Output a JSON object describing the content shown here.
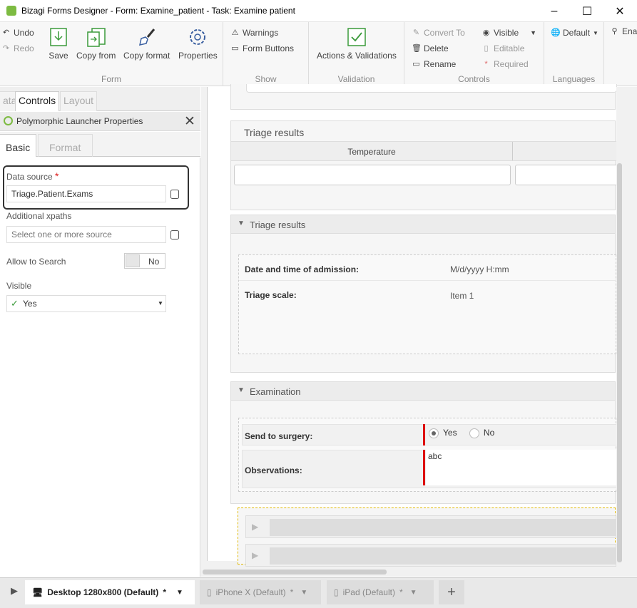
{
  "window": {
    "title": "Bizagi Forms Designer  - Form: Examine_patient - Task:  Examine patient",
    "minimize": "–",
    "maximize": "☐",
    "close": "✕"
  },
  "ribbon": {
    "undo": "Undo",
    "redo": "Redo",
    "save": "Save",
    "copy_from": "Copy from",
    "copy_format": "Copy format",
    "properties": "Properties",
    "group_form": "Form",
    "warnings": "Warnings",
    "form_buttons": "Form Buttons",
    "group_show": "Show",
    "actions_validations": "Actions & Validations",
    "group_validation": "Validation",
    "convert_to": "Convert To",
    "delete": "Delete",
    "rename": "Rename",
    "visible": "Visible",
    "editable": "Editable",
    "required": "Required",
    "group_controls": "Controls",
    "language_default": "Default",
    "group_languages": "Languages",
    "enable": "Ena"
  },
  "left_tabs": [
    "ata",
    "Controls",
    "Layout"
  ],
  "properties_panel": {
    "title": "Polymorphic Launcher Properties",
    "tabs": [
      "Basic",
      "Format"
    ],
    "data_source_label": "Data source",
    "data_source_required": "*",
    "data_source_value": "Triage.Patient.Exams",
    "additional_xpaths_label": "Additional xpaths",
    "additional_xpaths_placeholder": "Select one or more source",
    "allow_search_label": "Allow to Search",
    "allow_search_value": "No",
    "visible_label": "Visible",
    "visible_value": "Yes"
  },
  "form": {
    "grid_panel_title": "Triage results",
    "grid_column": "Temperature",
    "group1_title": "Triage results",
    "date_label": "Date and time of admission:",
    "date_value": "M/d/yyyy H:mm",
    "scale_label": "Triage scale:",
    "scale_value": "Item 1",
    "group2_title": "Examination",
    "surgery_label": "Send to surgery:",
    "surgery_yes": "Yes",
    "surgery_no": "No",
    "surgery_selected": "Yes",
    "observations_label": "Observations:",
    "observations_value": "abc"
  },
  "devices": [
    {
      "label": "Desktop 1280x800 (Default)",
      "mark": "*"
    },
    {
      "label": "iPhone X (Default)",
      "mark": "*"
    },
    {
      "label": "iPad (Default)",
      "mark": "*"
    }
  ],
  "add_device": "+"
}
